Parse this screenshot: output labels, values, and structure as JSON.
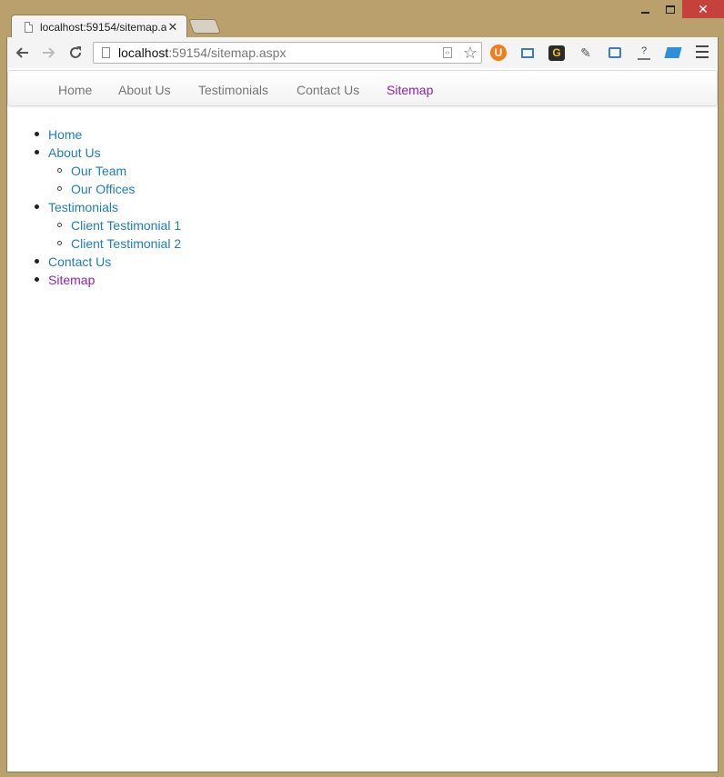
{
  "tab": {
    "title": "localhost:59154/sitemap.a",
    "close": "✕"
  },
  "window": {
    "close": "✕"
  },
  "address": {
    "host": "localhost",
    "path": ":59154/sitemap.aspx"
  },
  "navbar": {
    "items": [
      {
        "label": "Home",
        "active": false
      },
      {
        "label": "About Us",
        "active": false
      },
      {
        "label": "Testimonials",
        "active": false
      },
      {
        "label": "Contact Us",
        "active": false
      },
      {
        "label": "Sitemap",
        "active": true
      }
    ]
  },
  "sitemap": {
    "home": "Home",
    "about": "About Us",
    "our_team": "Our Team",
    "our_offices": "Our Offices",
    "testimonials": "Testimonials",
    "client_1": "Client Testimonial 1",
    "client_2": "Client Testimonial 2",
    "contact": "Contact Us",
    "sitemap": "Sitemap"
  },
  "colors": {
    "link": "#1f7dbb",
    "visited": "#9122ad",
    "frame": "#b9a06d"
  },
  "icons": [
    "back-icon",
    "forward-icon",
    "reload-icon",
    "page-icon",
    "star-icon",
    "menu-icon"
  ]
}
